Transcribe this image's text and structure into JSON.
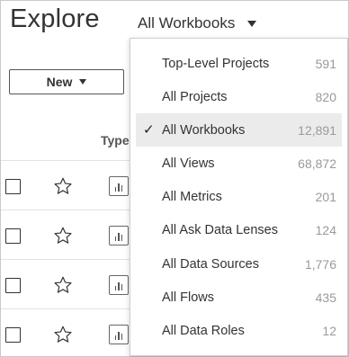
{
  "page": {
    "title": "Explore"
  },
  "view_selector": {
    "label": "All Workbooks",
    "icon": "chevron-down-icon"
  },
  "toolbar": {
    "new_label": "New",
    "new_icon": "caret-down-icon"
  },
  "table": {
    "columns": [
      {
        "label": "Type"
      }
    ],
    "rows": [
      {
        "checked": false,
        "favorite": false,
        "type_icon": "workbook-icon"
      },
      {
        "checked": false,
        "favorite": false,
        "type_icon": "workbook-icon"
      },
      {
        "checked": false,
        "favorite": false,
        "type_icon": "workbook-icon"
      },
      {
        "checked": false,
        "favorite": false,
        "type_icon": "workbook-icon"
      }
    ]
  },
  "dropdown": {
    "selected_index": 2,
    "items": [
      {
        "label": "Top-Level Projects",
        "count": "591"
      },
      {
        "label": "All Projects",
        "count": "820"
      },
      {
        "label": "All Workbooks",
        "count": "12,891"
      },
      {
        "label": "All Views",
        "count": "68,872"
      },
      {
        "label": "All Metrics",
        "count": "201"
      },
      {
        "label": "All Ask Data Lenses",
        "count": "124"
      },
      {
        "label": "All Data Sources",
        "count": "1,776"
      },
      {
        "label": "All Flows",
        "count": "435"
      },
      {
        "label": "All Data Roles",
        "count": "12"
      }
    ],
    "check_glyph": "✓"
  },
  "colors": {
    "selected_bg": "#ebebeb",
    "count_text": "#9a9a9a",
    "text": "#333333"
  }
}
